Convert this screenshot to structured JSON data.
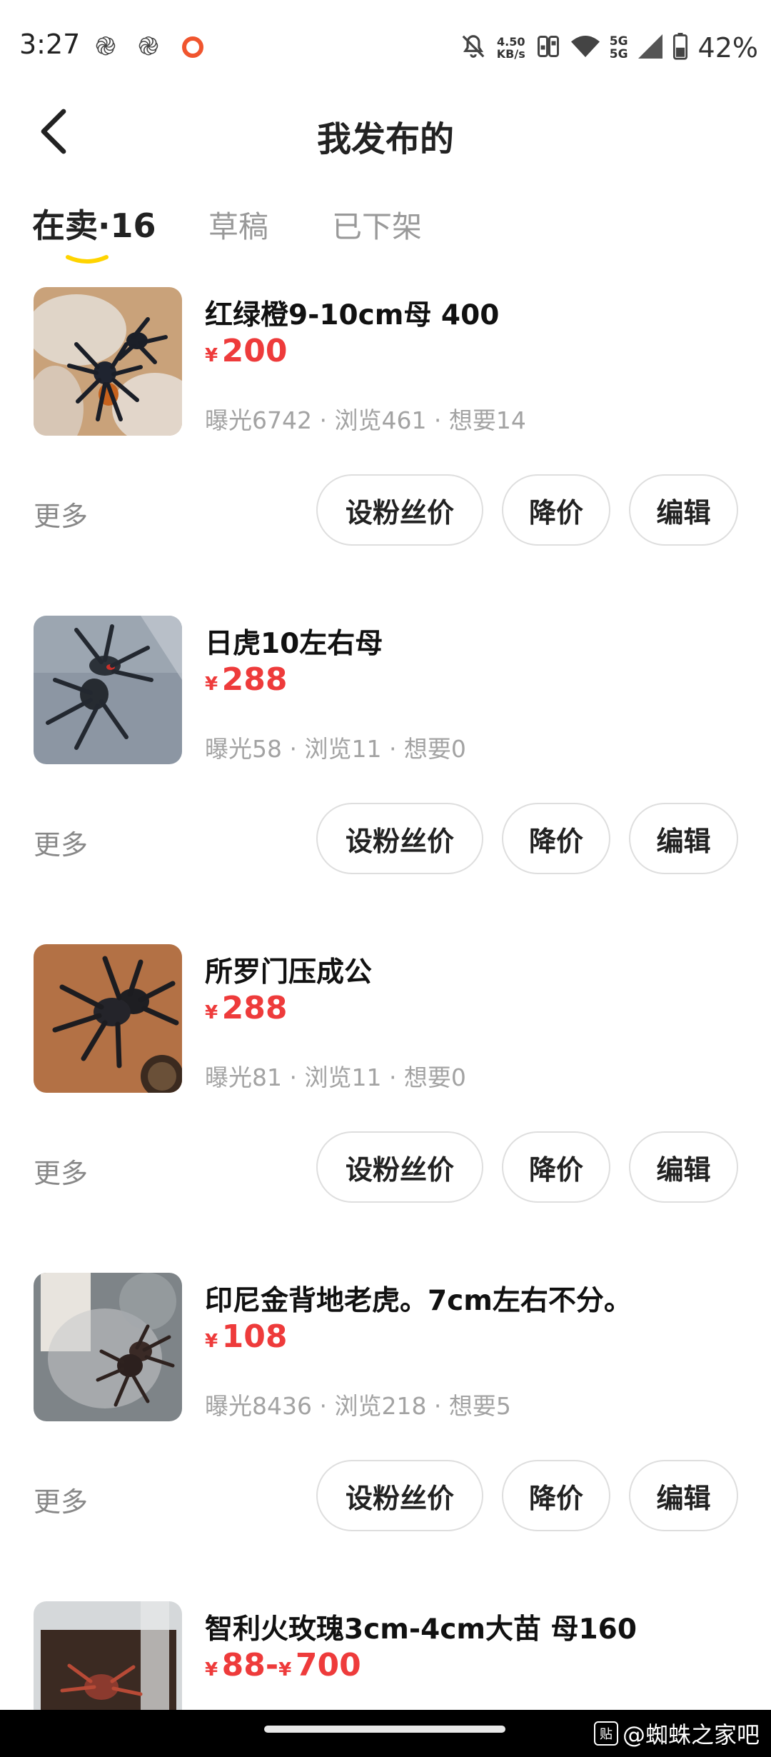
{
  "status_bar": {
    "time": "3:27",
    "net_speed_value": "4.50",
    "net_speed_unit": "KB/s",
    "signal_label_1": "5G",
    "signal_label_2": "5G",
    "battery_percent": "42%",
    "accent_ring_color": "#f0552e"
  },
  "header": {
    "back_icon": "chevron-left-icon",
    "title": "我发布的"
  },
  "tabs": [
    {
      "label": "在卖·16",
      "active": true
    },
    {
      "label": "草稿",
      "active": false
    },
    {
      "label": "已下架",
      "active": false
    }
  ],
  "tab_underline_color": "#ffd400",
  "price_color": "#ee3b3b",
  "listings": [
    {
      "title": "红绿橙9-10cm母 400",
      "currency": "¥",
      "price": "200",
      "stats": "曝光6742 · 浏览461 · 想要14",
      "more": "更多",
      "btn_fans_price": "设粉丝价",
      "btn_reduce": "降价",
      "btn_edit": "编辑"
    },
    {
      "title": "日虎10左右母",
      "currency": "¥",
      "price": "288",
      "stats": "曝光58 · 浏览11 · 想要0",
      "more": "更多",
      "btn_fans_price": "设粉丝价",
      "btn_reduce": "降价",
      "btn_edit": "编辑"
    },
    {
      "title": "所罗门压成公",
      "currency": "¥",
      "price": "288",
      "stats": "曝光81 · 浏览11 · 想要0",
      "more": "更多",
      "btn_fans_price": "设粉丝价",
      "btn_reduce": "降价",
      "btn_edit": "编辑"
    },
    {
      "title": "印尼金背地老虎。7cm左右不分。",
      "currency": "¥",
      "price": "108",
      "stats": "曝光8436 · 浏览218 · 想要5",
      "more": "更多",
      "btn_fans_price": "设粉丝价",
      "btn_reduce": "降价",
      "btn_edit": "编辑"
    },
    {
      "title": "智利火玫瑰3cm-4cm大苗  母160",
      "currency": "¥",
      "price": "88",
      "price_sep": "-",
      "currency2": "¥",
      "price_max": "700"
    }
  ],
  "watermark": {
    "logo_text": "贴",
    "text": "@蜘蛛之家吧"
  }
}
